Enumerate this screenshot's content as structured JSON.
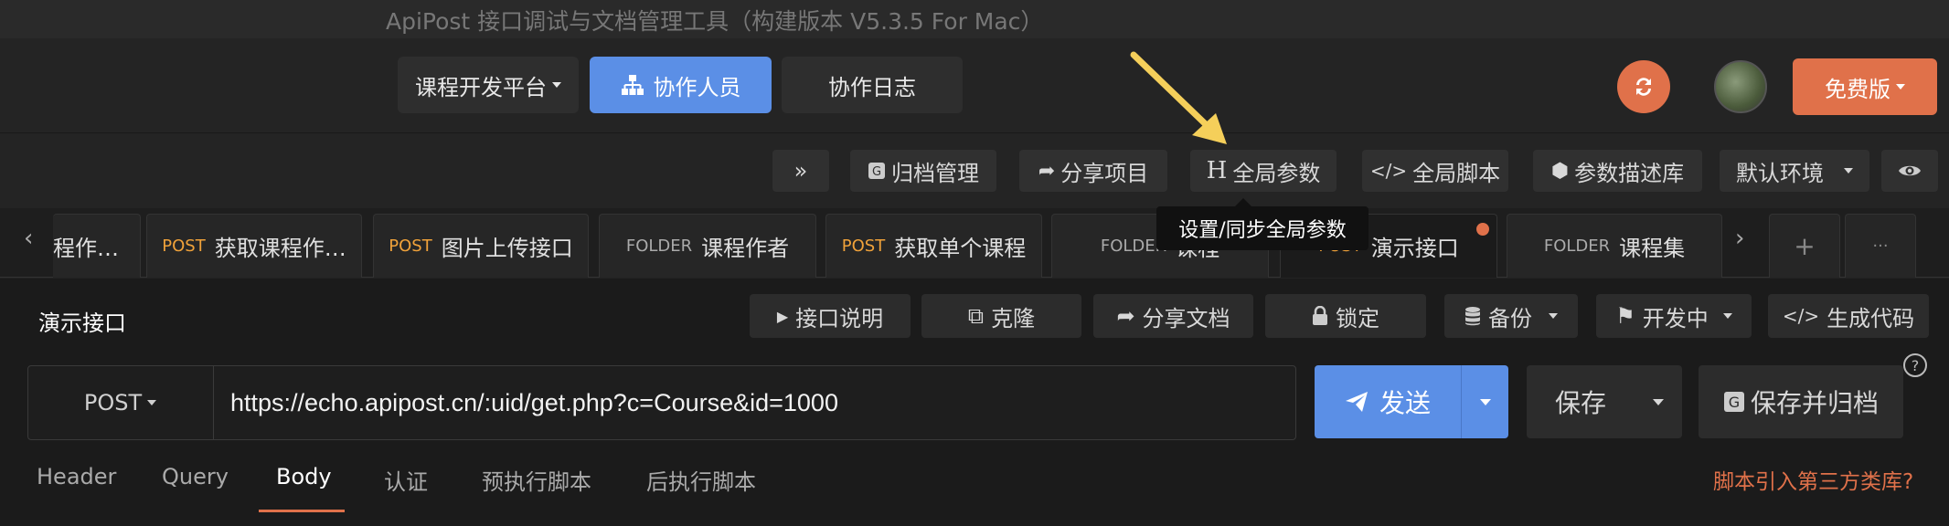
{
  "window": {
    "title": "ApiPost 接口调试与文档管理工具（构建版本 V5.3.5 For Mac）"
  },
  "topnav": {
    "project_label": "课程开发平台",
    "collaborators_label": "协作人员",
    "collab_log_label": "协作日志",
    "plan_label": "免费版"
  },
  "toolbar": {
    "expand_label": "»",
    "archive_label": "归档管理",
    "share_project_label": "分享项目",
    "global_params_label": "全局参数",
    "global_script_label": "全局脚本",
    "param_library_label": "参数描述库",
    "env_label": "默认环境"
  },
  "tooltip": {
    "text": "设置/同步全局参数"
  },
  "tabs": [
    {
      "method": "",
      "name": "程作…"
    },
    {
      "method": "POST",
      "name": "获取课程作…"
    },
    {
      "method": "POST",
      "name": "图片上传接口"
    },
    {
      "method": "FOLDER",
      "name": "课程作者"
    },
    {
      "method": "POST",
      "name": "获取单个课程"
    },
    {
      "method": "FOLDER",
      "name": "课程"
    },
    {
      "method": "POST",
      "name": "演示接口"
    },
    {
      "method": "FOLDER",
      "name": "课程集"
    }
  ],
  "tabs_controls": {
    "add": "+",
    "more": "···"
  },
  "api": {
    "title": "演示接口",
    "doc_label": "接口说明",
    "clone_label": "克隆",
    "share_doc_label": "分享文档",
    "lock_label": "锁定",
    "backup_label": "备份",
    "status_label": "开发中",
    "gencode_label": "生成代码"
  },
  "request": {
    "method": "POST",
    "url": "https://echo.apipost.cn/:uid/get.php?c=Course&id=1000",
    "send_label": "发送",
    "save_label": "保存",
    "save_archive_label": "保存并归档",
    "help": "?"
  },
  "subtabs": [
    "Header",
    "Query",
    "Body",
    "认证",
    "预执行脚本",
    "后执行脚本"
  ],
  "subtabs_active": "Body",
  "third_party_link": "脚本引入第三方类库?",
  "colors": {
    "accent_blue": "#5b8fe6",
    "accent_orange": "#e0714a",
    "post": "#f0a23a",
    "annotation": "#f5cf5a"
  }
}
